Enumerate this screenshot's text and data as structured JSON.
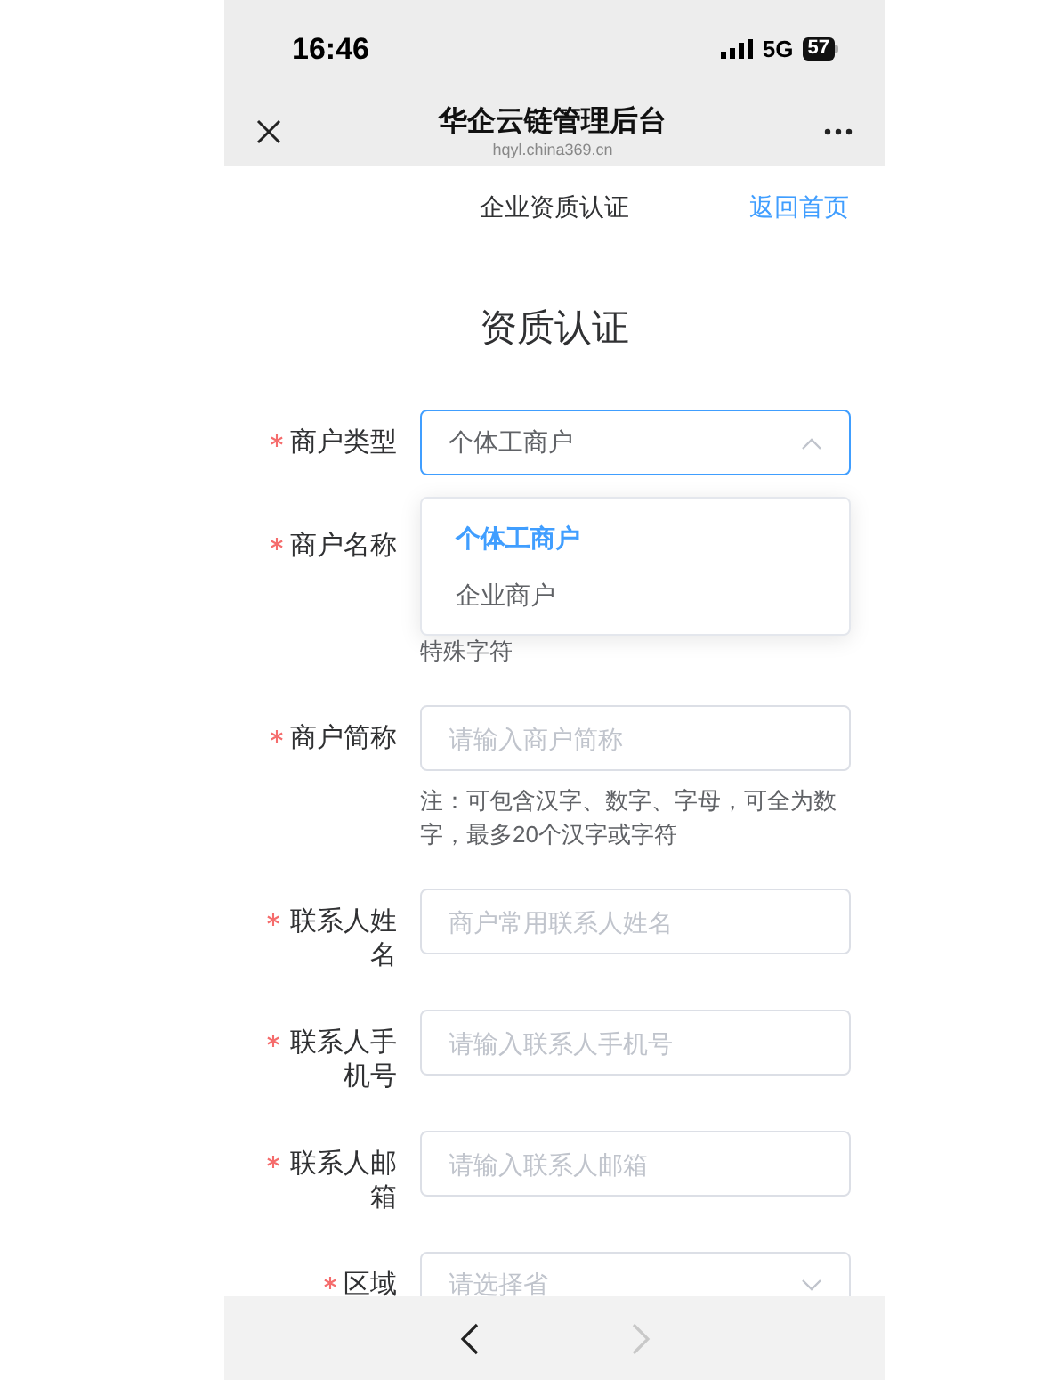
{
  "status_bar": {
    "time": "16:46",
    "network": "5G",
    "battery": "57"
  },
  "nav_bar": {
    "title": "华企云链管理后台",
    "url": "hqyl.china369.cn"
  },
  "header": {
    "title": "企业资质认证",
    "link": "返回首页"
  },
  "page_title": "资质认证",
  "fields": [
    {
      "kind": "select",
      "required": true,
      "label": "商户类型",
      "value": "个体工商户",
      "expanded": true,
      "options": [
        {
          "label": "个体工商户",
          "selected": true
        },
        {
          "label": "企业商户",
          "selected": false
        }
      ]
    },
    {
      "kind": "covered",
      "required": true,
      "label": "商户名称",
      "note": "特殊字符"
    },
    {
      "kind": "input",
      "required": true,
      "label": "商户简称",
      "placeholder": "请输入商户简称",
      "note": "注：可包含汉字、数字、字母，可全为数字，最多20个汉字或字符"
    },
    {
      "kind": "input",
      "required": true,
      "label": "联系人姓名",
      "placeholder": "商户常用联系人姓名"
    },
    {
      "kind": "input",
      "required": true,
      "label": "联系人手机号",
      "placeholder": "请输入联系人手机号"
    },
    {
      "kind": "input",
      "required": true,
      "label": "联系人邮箱",
      "placeholder": "请输入联系人邮箱"
    },
    {
      "kind": "select",
      "required": true,
      "label": "区域",
      "placeholder": "请选择省",
      "expanded": false
    }
  ],
  "bottom_bar": {
    "back_disabled": false,
    "forward_disabled": true
  }
}
